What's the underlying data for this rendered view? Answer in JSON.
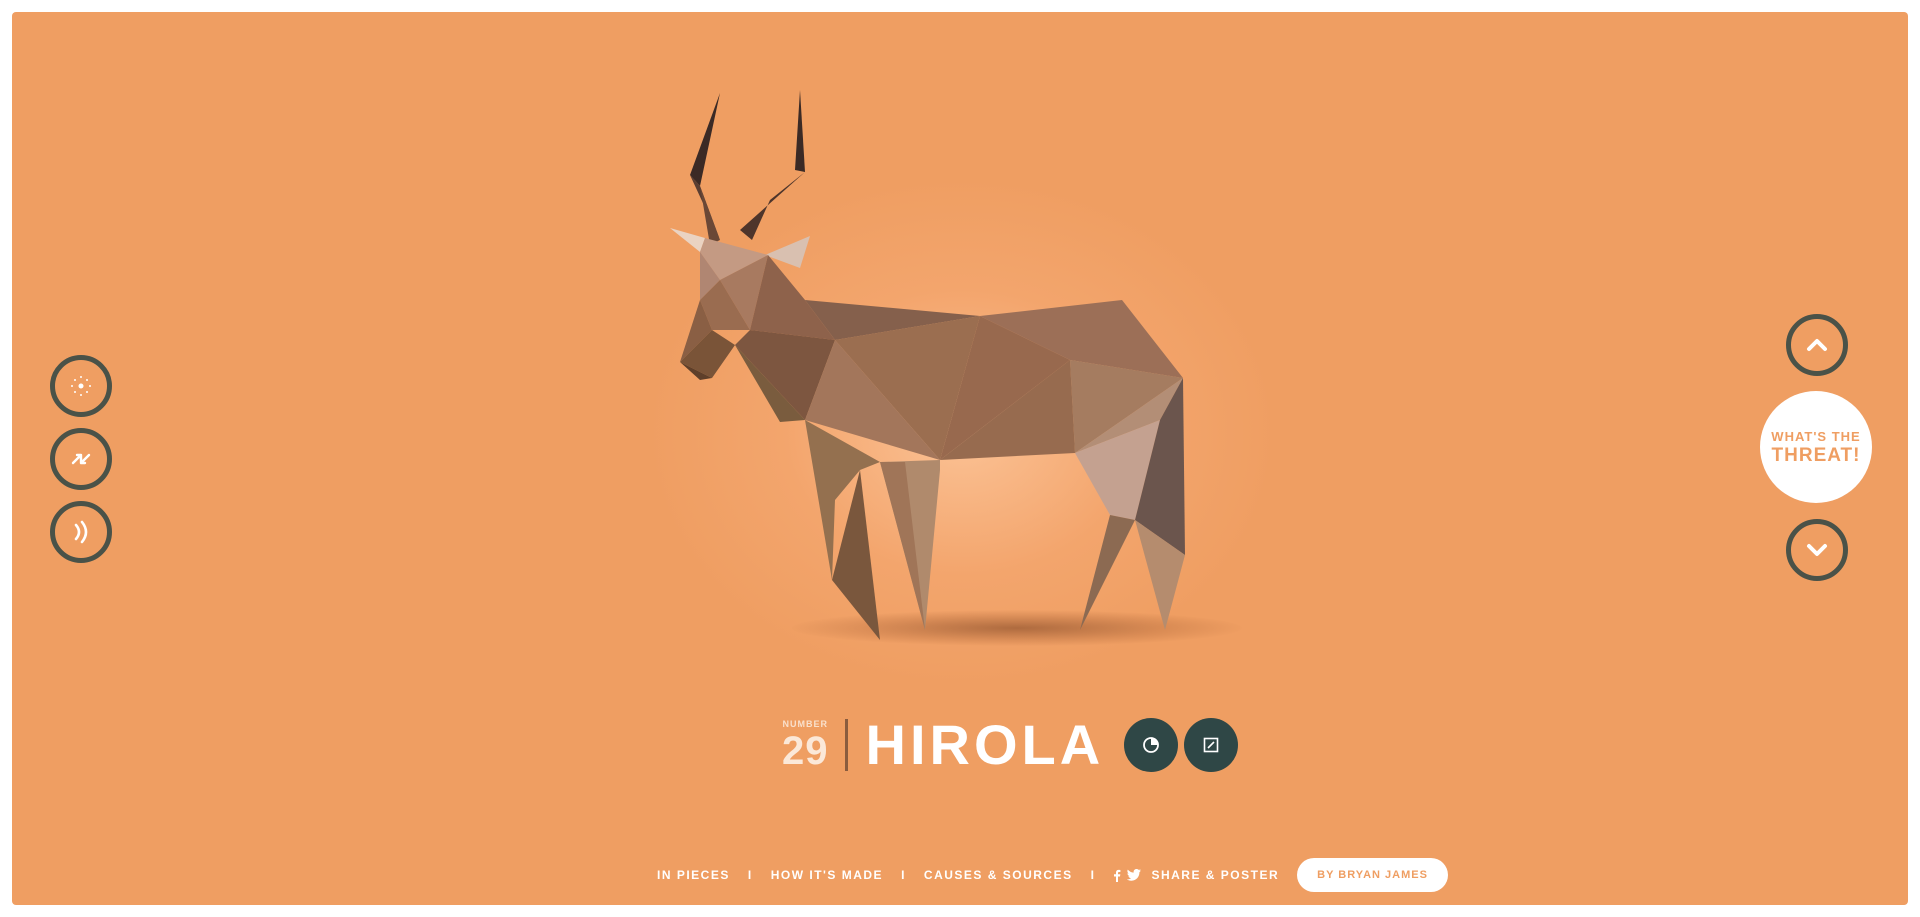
{
  "colors": {
    "background": "#EF9E62",
    "ring": "#4a5248",
    "dark_button": "#2f4746",
    "white": "#ffffff"
  },
  "left_controls": [
    {
      "name": "particles-icon"
    },
    {
      "name": "shuffle-icon"
    },
    {
      "name": "sound-icon"
    }
  ],
  "right_controls": {
    "up_icon": "chevron-up-icon",
    "down_icon": "chevron-down-icon",
    "threat_line1": "WHAT'S THE",
    "threat_line2": "THREAT!"
  },
  "species": {
    "number_label": "NUMBER",
    "number": "29",
    "name": "HIROLA"
  },
  "footer": {
    "links": [
      "IN PIECES",
      "HOW IT'S MADE",
      "CAUSES & SOURCES"
    ],
    "separator": "I",
    "share_label": "SHARE & POSTER",
    "author_button": "BY BRYAN JAMES"
  }
}
